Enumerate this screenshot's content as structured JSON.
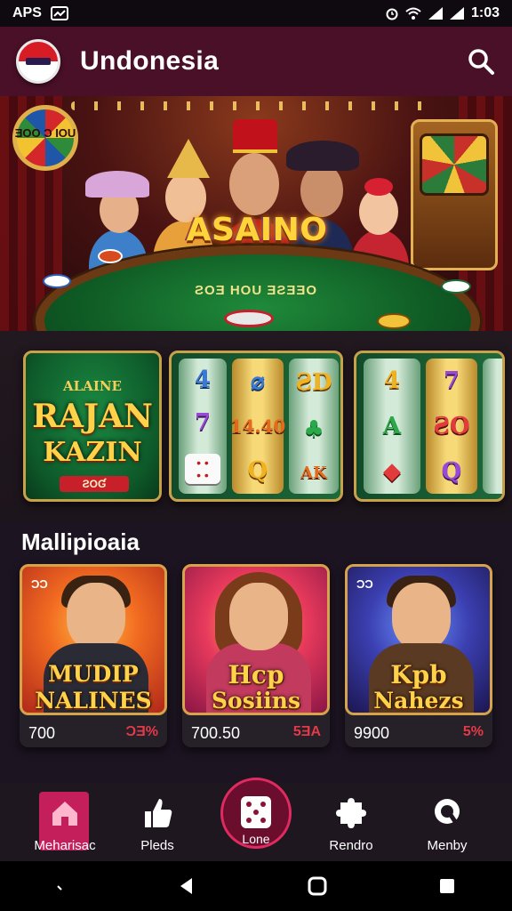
{
  "status_bar": {
    "left_text": "APS",
    "right_text": "1:03"
  },
  "app_bar": {
    "title": "Undonesia"
  },
  "banner": {
    "logo_text": "ASAINO",
    "table_text": "ƧOƎ HOU ƎƧƎƎO",
    "wheel_text": "ƎOO Ɔ IOU"
  },
  "featured_games": [
    {
      "line1": "ALAINE",
      "line2": "RAJAN",
      "line3": "KAZIN",
      "tag": "ƧOƓ"
    },
    {
      "reels": [
        [
          "4",
          "7",
          "die"
        ],
        [
          "⌀",
          "14.40",
          "Q"
        ],
        [
          "ƧD",
          "♣",
          "AK"
        ]
      ]
    },
    {
      "reels": [
        [
          "4",
          "A",
          "◆"
        ],
        [
          "7",
          "ƧO",
          "Q"
        ],
        [
          "",
          "",
          ""
        ]
      ]
    }
  ],
  "section_title": "Mallipioaia",
  "promo_cards": [
    {
      "corner": "ƆƆ",
      "title1": "MUDIP",
      "title2": "NALINES",
      "value": "700",
      "badge": "ƆƎ%"
    },
    {
      "corner": "",
      "title1": "Hcp",
      "title2": "Sosiins",
      "value": "700.50",
      "badge": "5ƎA"
    },
    {
      "corner": "ƆƆ",
      "title1": "Kpb",
      "title2": "Nahezs",
      "value": "9900",
      "badge": "5%"
    }
  ],
  "nav": {
    "items": [
      {
        "label": "Meharisac",
        "icon": "home-icon"
      },
      {
        "label": "Pleds",
        "icon": "thumbs-up-icon"
      },
      {
        "label": "Lone",
        "icon": "dice-icon"
      },
      {
        "label": "Rendro",
        "icon": "puzzle-icon"
      },
      {
        "label": "Menby",
        "icon": "magnifier-icon"
      }
    ]
  },
  "colors": {
    "appbar": "#4a1027",
    "accent": "#c41f5a",
    "gold": "#ffd24a",
    "background": "#1c1421"
  }
}
